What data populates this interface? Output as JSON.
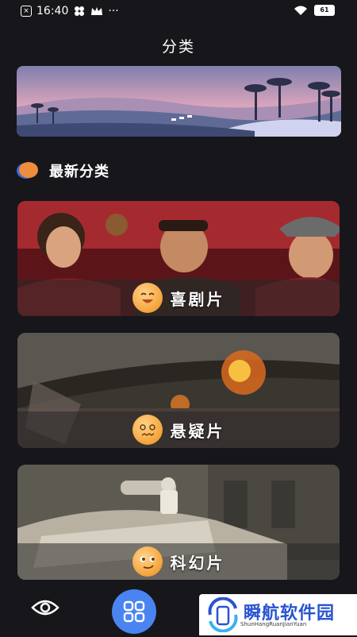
{
  "status_bar": {
    "time": "16:40",
    "battery": "61"
  },
  "header": {
    "title": "分类"
  },
  "section": {
    "title": "最新分类"
  },
  "categories": [
    {
      "label": "喜剧片"
    },
    {
      "label": "悬疑片"
    },
    {
      "label": "科幻片"
    }
  ],
  "bottom_nav": {
    "active": "grid"
  },
  "watermark": {
    "text": "瞬航软件园",
    "sub": "ShunHangRuanJianYuan"
  },
  "colors": {
    "background": "#17161b",
    "accent": "#4a84f1",
    "section_icon": "#f08c3c"
  }
}
